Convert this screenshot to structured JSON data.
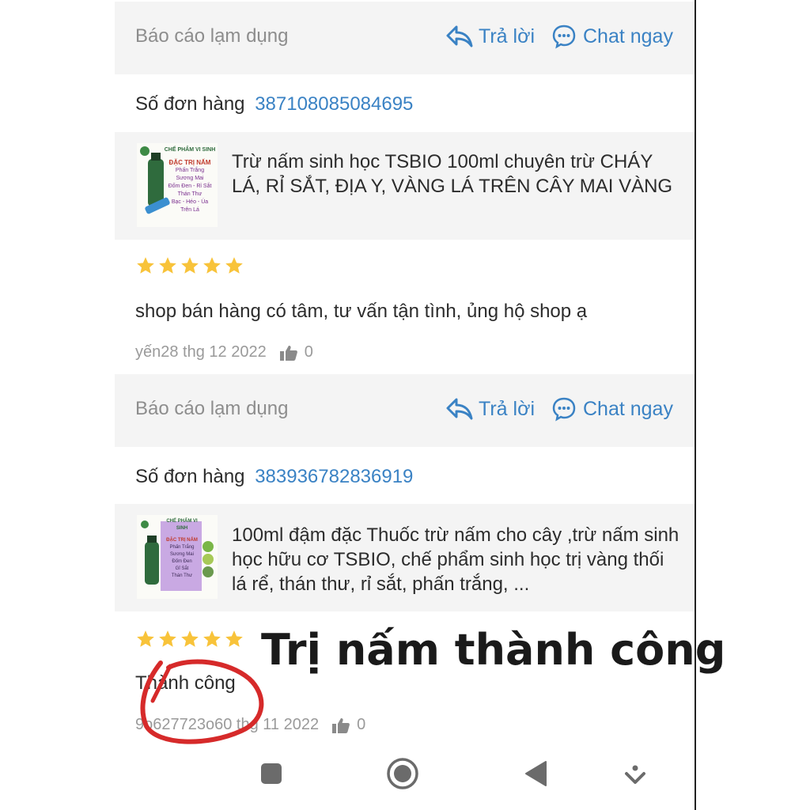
{
  "reviews": [
    {
      "report_label": "Báo cáo lạm dụng",
      "reply_label": "Trả lời",
      "chat_label": "Chat ngay",
      "order_label": "Số đơn hàng",
      "order_number": "387108085084695",
      "product_title": "Trừ nấm sinh học TSBIO 100ml chuyên trừ CHÁY LÁ, RỈ SẮT, ĐỊA Y, VÀNG LÁ TRÊN CÂY MAI VÀNG",
      "thumb_text": [
        "CHẾ PHẨM VI SINH",
        "ĐẶC TRỊ NẤM",
        "Phấn Trắng",
        "Sương Mai",
        "Đốm Đen - Rỉ Sắt",
        "Thán Thư",
        "Bạc - Héo - Úa",
        "Trên Lá"
      ],
      "rating": 5,
      "review_text": "shop bán hàng có tâm, tư vấn tận tình, ủng hộ shop ạ",
      "meta_user_date": "yến28 thg 12 2022",
      "likes": "0"
    },
    {
      "report_label": "Báo cáo lạm dụng",
      "reply_label": "Trả lời",
      "chat_label": "Chat ngay",
      "order_label": "Số đơn hàng",
      "order_number": "383936782836919",
      "product_title": "100ml đậm đặc Thuốc trừ nấm cho cây ,trừ nấm sinh học hữu cơ TSBIO, chế phẩm sinh học trị vàng thối lá rể, thán thư, rỉ sắt, phấn trắng, ...",
      "thumb_text": [
        "CHẾ PHẨM VI SINH",
        "ĐẶC TRỊ NẤM",
        "Phấn Trắng",
        "Sương Mai",
        "Đốm Đen",
        "Gỉ Sắt",
        "Thán Thư"
      ],
      "rating": 5,
      "review_text": "Thành công",
      "meta_user_date": "9o627723o60 thg 11 2022",
      "likes": "0"
    }
  ],
  "overlay_caption": "Trị nấm thành công",
  "nav": {
    "buttons": [
      "recent-apps",
      "home",
      "back",
      "notification-pull"
    ]
  },
  "colors": {
    "accent": "#3a82c4",
    "star": "#f8c33a",
    "annotation": "#d62a2a"
  }
}
